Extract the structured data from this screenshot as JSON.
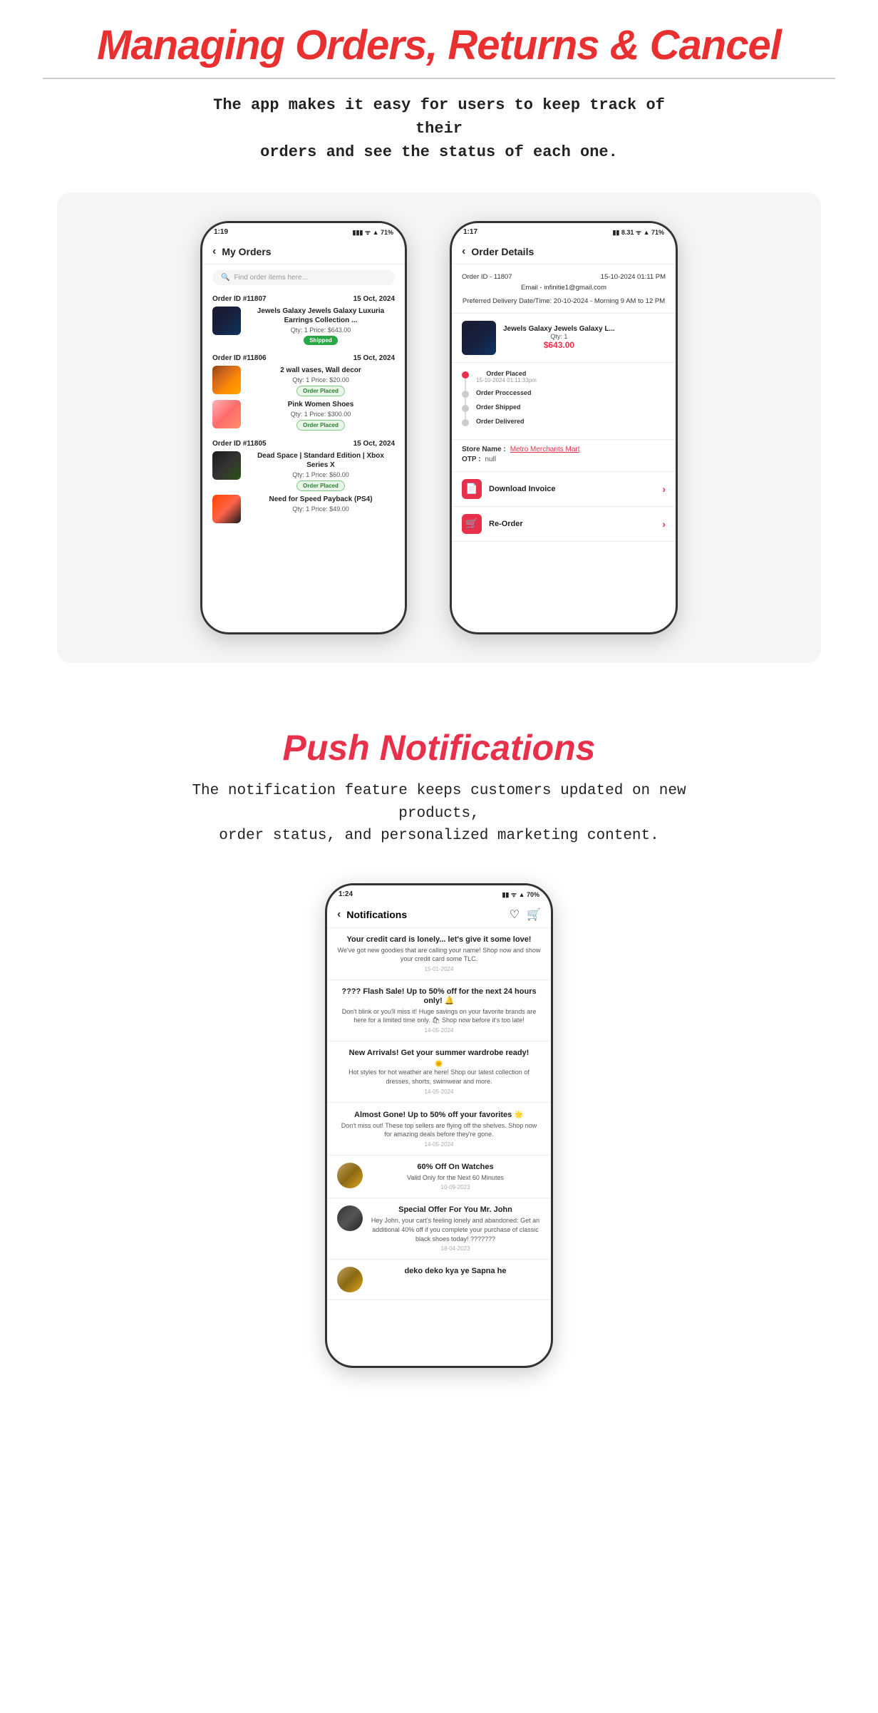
{
  "section1": {
    "title": "Managing Orders, Returns & Cancel",
    "divider": true,
    "subtitle": "The app makes it easy for users to keep track of their\norders and see the status of each one.",
    "left_phone": {
      "status_time": "1:19",
      "status_icons": "▮▮▮ ᯤ .ull 71%",
      "header": "My Orders",
      "search_placeholder": "Find order items here...",
      "orders": [
        {
          "id": "Order ID #11807",
          "date": "15 Oct, 2024",
          "items": [
            {
              "name": "Jewels Galaxy Jewels Galaxy Luxuria Earrings Collection ...",
              "qty_price": "Qty: 1  Price: $643.00",
              "status": "Shipped",
              "status_type": "shipped",
              "img_type": "jewelry"
            }
          ]
        },
        {
          "id": "Order ID #11806",
          "date": "15 Oct, 2024",
          "items": [
            {
              "name": "2 wall vases, Wall decor",
              "qty_price": "Qty: 1  Price: $20.00",
              "status": "Order Placed",
              "status_type": "order-placed",
              "img_type": "vases"
            },
            {
              "name": "Pink Women Shoes",
              "qty_price": "Qty: 1  Price: $300.00",
              "status": "Order Placed",
              "status_type": "order-placed",
              "img_type": "shoes"
            }
          ]
        },
        {
          "id": "Order ID #11805",
          "date": "15 Oct, 2024",
          "items": [
            {
              "name": "Dead Space | Standard Edition | Xbox Series X",
              "qty_price": "Qty: 1  Price: $60.00",
              "status": "Order Placed",
              "status_type": "order-placed",
              "img_type": "xbox"
            },
            {
              "name": "Need for Speed Payback (PS4)",
              "qty_price": "Qty: 1  Price: $49.00",
              "status": "",
              "status_type": "",
              "img_type": "nfs"
            }
          ]
        }
      ]
    },
    "right_phone": {
      "status_time": "1:17",
      "status_icons": "▮▮ 8.31 ᯤ .ull 71%",
      "header": "Order Details",
      "order_id": "Order ID - 11807",
      "date_time": "15-10-2024 01:11 PM",
      "email": "Email - infinitie1@gmail.com",
      "delivery": "Preferred Delivery Date/Time: 20-10-2024 - Morning 9 AM to 12 PM",
      "product_name": "Jewels Galaxy Jewels Galaxy L...",
      "product_qty": "Qty: 1",
      "product_price": "$643.00",
      "timeline": [
        {
          "label": "Order Placed",
          "date": "15-10-2024 01:11:33pm",
          "active": true
        },
        {
          "label": "Order Proccessed",
          "date": "",
          "active": false
        },
        {
          "label": "Order Shipped",
          "date": "",
          "active": false
        },
        {
          "label": "Order Delivered",
          "date": "",
          "active": false
        }
      ],
      "store_label": "Store Name :",
      "store_value": "Metro Merchants Mart",
      "otp_label": "OTP :",
      "otp_value": "null",
      "actions": [
        {
          "label": "Download Invoice",
          "icon": "📄",
          "icon_type": "red"
        },
        {
          "label": "Re-Order",
          "icon": "🛒",
          "icon_type": "cart"
        }
      ]
    }
  },
  "section2": {
    "title": "Push Notifications",
    "subtitle": "The notification feature keeps customers updated on new products,\norder status, and personalized marketing content.",
    "phone": {
      "status_time": "1:24",
      "status_icons": "▮▮ ᯤ .ull 70%",
      "header": "Notifications",
      "notifications": [
        {
          "title": "Your credit card is lonely... let's give it some love!",
          "body": "We've got new goodies that are calling your name! Shop now and show your credit card some TLC.",
          "date": "15-01-2024",
          "has_avatar": false
        },
        {
          "title": "???? Flash Sale! Up to 50% off for the next 24 hours only! 🔔",
          "body": "Don't blink or you'll miss it! Huge savings on your favorite brands are here for a limited time only. 🛍 Shop now before it's too late!",
          "date": "14-05-2024",
          "has_avatar": false
        },
        {
          "title": "New Arrivals! Get your summer wardrobe ready!",
          "body": "🌞\nHot styles for hot weather are here! Shop our latest collection of dresses, shorts, swimwear and more.",
          "date": "14-05-2024",
          "has_avatar": false
        },
        {
          "title": "Almost Gone! Up to 50% off your favorites 🌟",
          "body": "Don't miss out! These top sellers are flying off the shelves. Shop now for amazing deals before they're gone.",
          "date": "14-05-2024",
          "has_avatar": false
        },
        {
          "title": "60% Off On Watches",
          "body": "Valid Only for the Next 60 Minutes",
          "date": "10-09-2023",
          "has_avatar": true,
          "avatar_type": "watch"
        },
        {
          "title": "Special Offer For You Mr. John",
          "body": "Hey John, your cart's feeling lonely and abandoned: Get an additional 40% off if you complete your purchase of classic black shoes today! ???????",
          "date": "18-04-2023",
          "has_avatar": true,
          "avatar_type": "cart"
        },
        {
          "title": "deko deko kya ye Sapna he",
          "body": "",
          "date": "",
          "has_avatar": true,
          "avatar_type": "watch"
        }
      ]
    }
  }
}
